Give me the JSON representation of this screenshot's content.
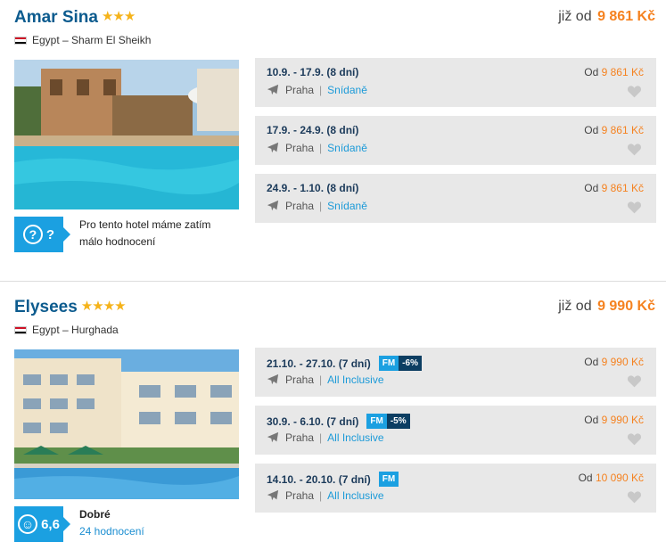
{
  "hotels": [
    {
      "name": "Amar Sina",
      "stars": "★★★",
      "price_prefix": "již od",
      "price": "9 861 Kč",
      "location": "Egypt – Sharm El Sheikh",
      "rating_badge": "?",
      "rating_title": "Pro tento hotel máme zatím",
      "rating_sub": "málo hodnocení",
      "offers": [
        {
          "dates": "10.9. - 17.9. (8 dní)",
          "from": "Praha",
          "board": "Snídaně",
          "price_prefix": "Od",
          "price": "9 861 Kč"
        },
        {
          "dates": "17.9. - 24.9. (8 dní)",
          "from": "Praha",
          "board": "Snídaně",
          "price_prefix": "Od",
          "price": "9 861 Kč"
        },
        {
          "dates": "24.9. - 1.10. (8 dní)",
          "from": "Praha",
          "board": "Snídaně",
          "price_prefix": "Od",
          "price": "9 861 Kč"
        }
      ]
    },
    {
      "name": "Elysees",
      "stars": "★★★★",
      "price_prefix": "již od",
      "price": "9 990 Kč",
      "location": "Egypt – Hurghada",
      "rating_badge": "6,6",
      "rating_title": "Dobré",
      "rating_sub": "24 hodnocení",
      "offers": [
        {
          "dates": "21.10. - 27.10. (7 dní)",
          "fm": "FM",
          "discount": "-6%",
          "from": "Praha",
          "board": "All Inclusive",
          "price_prefix": "Od",
          "price": "9 990 Kč"
        },
        {
          "dates": "30.9. - 6.10. (7 dní)",
          "fm": "FM",
          "discount": "-5%",
          "from": "Praha",
          "board": "All Inclusive",
          "price_prefix": "Od",
          "price": "9 990 Kč"
        },
        {
          "dates": "14.10. - 20.10. (7 dní)",
          "fm": "FM",
          "from": "Praha",
          "board": "All Inclusive",
          "price_prefix": "Od",
          "price": "10 090 Kč"
        }
      ]
    }
  ],
  "colors": {
    "accent": "#1ba0e1",
    "price": "#f58220",
    "title": "#0c5b8e",
    "star": "#f5b31a",
    "offer_bg": "#e8e8e8"
  },
  "icons": {
    "flag": "egypt-flag-icon",
    "plane": "plane-icon",
    "heart": "heart-icon",
    "question": "question-icon",
    "smile": "smile-icon"
  }
}
